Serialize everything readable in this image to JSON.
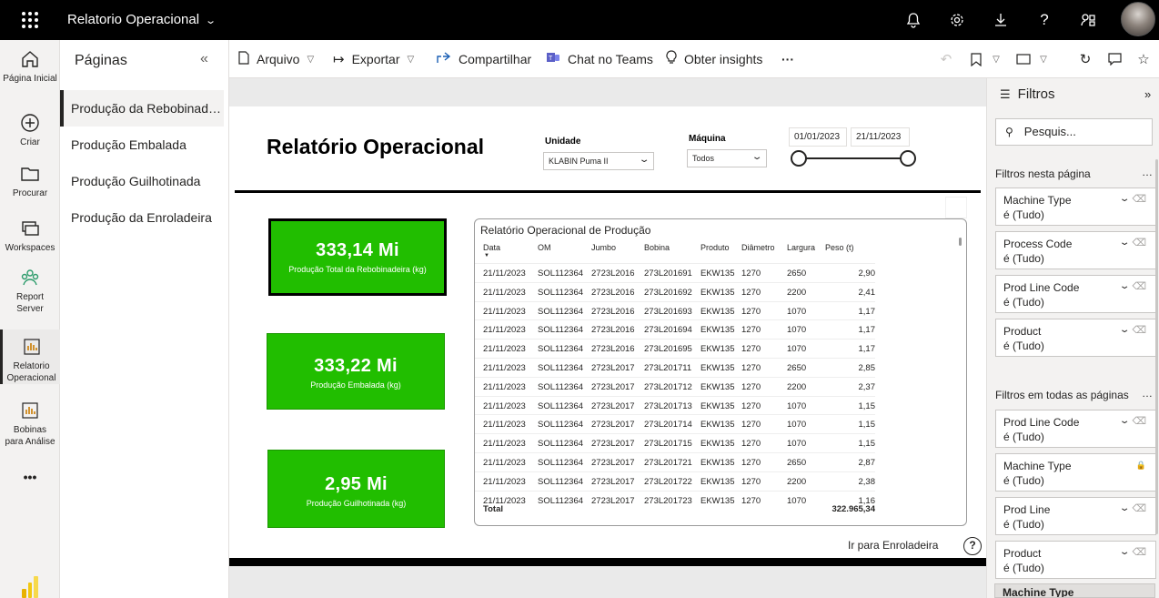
{
  "topbar": {
    "app_title": "Relatorio Operacional",
    "icons": [
      "bell-icon",
      "gear-icon",
      "download-icon",
      "help-icon",
      "share-icon"
    ]
  },
  "leftnav": {
    "items": [
      {
        "label": "Página Inicial",
        "icon": "home-icon"
      },
      {
        "label": "Criar",
        "icon": "plus-circle-icon"
      },
      {
        "label": "Procurar",
        "icon": "folder-icon"
      },
      {
        "label": "Workspaces",
        "icon": "workspaces-icon"
      },
      {
        "label": "Report Server",
        "icon": "report-server-icon"
      },
      {
        "label": "Relatorio Operacional",
        "icon": "report-icon"
      },
      {
        "label": "Bobinas para Análise",
        "icon": "report-icon"
      }
    ],
    "more": "•••"
  },
  "pages": {
    "title": "Páginas",
    "items": [
      "Produção da Rebobinadeira",
      "Produção Embalada",
      "Produção Guilhotinada",
      "Produção da Enroladeira"
    ]
  },
  "toolbar": {
    "arquivo": "Arquivo",
    "exportar": "Exportar",
    "compartilhar": "Compartilhar",
    "chat_teams": "Chat no Teams",
    "obter_insights": "Obter insights",
    "more": "···"
  },
  "report": {
    "title": "Relatório Operacional",
    "unidade_label": "Unidade",
    "unidade_value": "KLABIN Puma II",
    "maquina_label": "Máquina",
    "maquina_value": "Todos",
    "date_start": "01/01/2023",
    "date_end": "21/11/2023",
    "kpis": [
      {
        "value": "333,14 Mi",
        "label": "Produção Total da Rebobinadeira (kg)"
      },
      {
        "value": "333,22 Mi",
        "label": "Produção Embalada (kg)"
      },
      {
        "value": "2,95 Mi",
        "label": "Produção Guilhotinada (kg)"
      }
    ],
    "table": {
      "title": "Relatório Operacional de Produção",
      "columns": [
        "Data",
        "OM",
        "Jumbo",
        "Bobina",
        "Produto",
        "Diâmetro",
        "Largura",
        "Peso (t)"
      ],
      "rows": [
        [
          "21/11/2023",
          "SOL112364",
          "2723L2016",
          "273L201691",
          "EKW135",
          "1270",
          "2650",
          "2,90"
        ],
        [
          "21/11/2023",
          "SOL112364",
          "2723L2016",
          "273L201692",
          "EKW135",
          "1270",
          "2200",
          "2,41"
        ],
        [
          "21/11/2023",
          "SOL112364",
          "2723L2016",
          "273L201693",
          "EKW135",
          "1270",
          "1070",
          "1,17"
        ],
        [
          "21/11/2023",
          "SOL112364",
          "2723L2016",
          "273L201694",
          "EKW135",
          "1270",
          "1070",
          "1,17"
        ],
        [
          "21/11/2023",
          "SOL112364",
          "2723L2016",
          "273L201695",
          "EKW135",
          "1270",
          "1070",
          "1,17"
        ],
        [
          "21/11/2023",
          "SOL112364",
          "2723L2017",
          "273L201711",
          "EKW135",
          "1270",
          "2650",
          "2,85"
        ],
        [
          "21/11/2023",
          "SOL112364",
          "2723L2017",
          "273L201712",
          "EKW135",
          "1270",
          "2200",
          "2,37"
        ],
        [
          "21/11/2023",
          "SOL112364",
          "2723L2017",
          "273L201713",
          "EKW135",
          "1270",
          "1070",
          "1,15"
        ],
        [
          "21/11/2023",
          "SOL112364",
          "2723L2017",
          "273L201714",
          "EKW135",
          "1270",
          "1070",
          "1,15"
        ],
        [
          "21/11/2023",
          "SOL112364",
          "2723L2017",
          "273L201715",
          "EKW135",
          "1270",
          "1070",
          "1,15"
        ],
        [
          "21/11/2023",
          "SOL112364",
          "2723L2017",
          "273L201721",
          "EKW135",
          "1270",
          "2650",
          "2,87"
        ],
        [
          "21/11/2023",
          "SOL112364",
          "2723L2017",
          "273L201722",
          "EKW135",
          "1270",
          "2200",
          "2,38"
        ],
        [
          "21/11/2023",
          "SOL112364",
          "2723L2017",
          "273L201723",
          "EKW135",
          "1270",
          "1070",
          "1,16"
        ]
      ],
      "total_label": "Total",
      "total_value": "322.965,34"
    },
    "nav_link": "Ir para Enroladeira",
    "help": "?"
  },
  "filters": {
    "title": "Filtros",
    "search_placeholder": "Pesquis...",
    "section_page": "Filtros nesta página",
    "section_all": "Filtros em todas as páginas",
    "page_filters": [
      {
        "name": "Machine Type",
        "state": "é (Tudo)"
      },
      {
        "name": "Process Code",
        "state": "é (Tudo)"
      },
      {
        "name": "Prod Line Code",
        "state": "é (Tudo)"
      },
      {
        "name": "Product",
        "state": "é (Tudo)"
      }
    ],
    "all_filters": [
      {
        "name": "Prod Line Code",
        "state": "é (Tudo)",
        "locked": false
      },
      {
        "name": "Machine Type",
        "state": "é (Tudo)",
        "locked": true
      },
      {
        "name": "Prod Line",
        "state": "é (Tudo)",
        "locked": false
      },
      {
        "name": "Product",
        "state": "é (Tudo)",
        "locked": false
      }
    ],
    "partial_card": "Machine Type"
  },
  "colors": {
    "kpi_green": "#21be00",
    "topbar": "#000000"
  }
}
